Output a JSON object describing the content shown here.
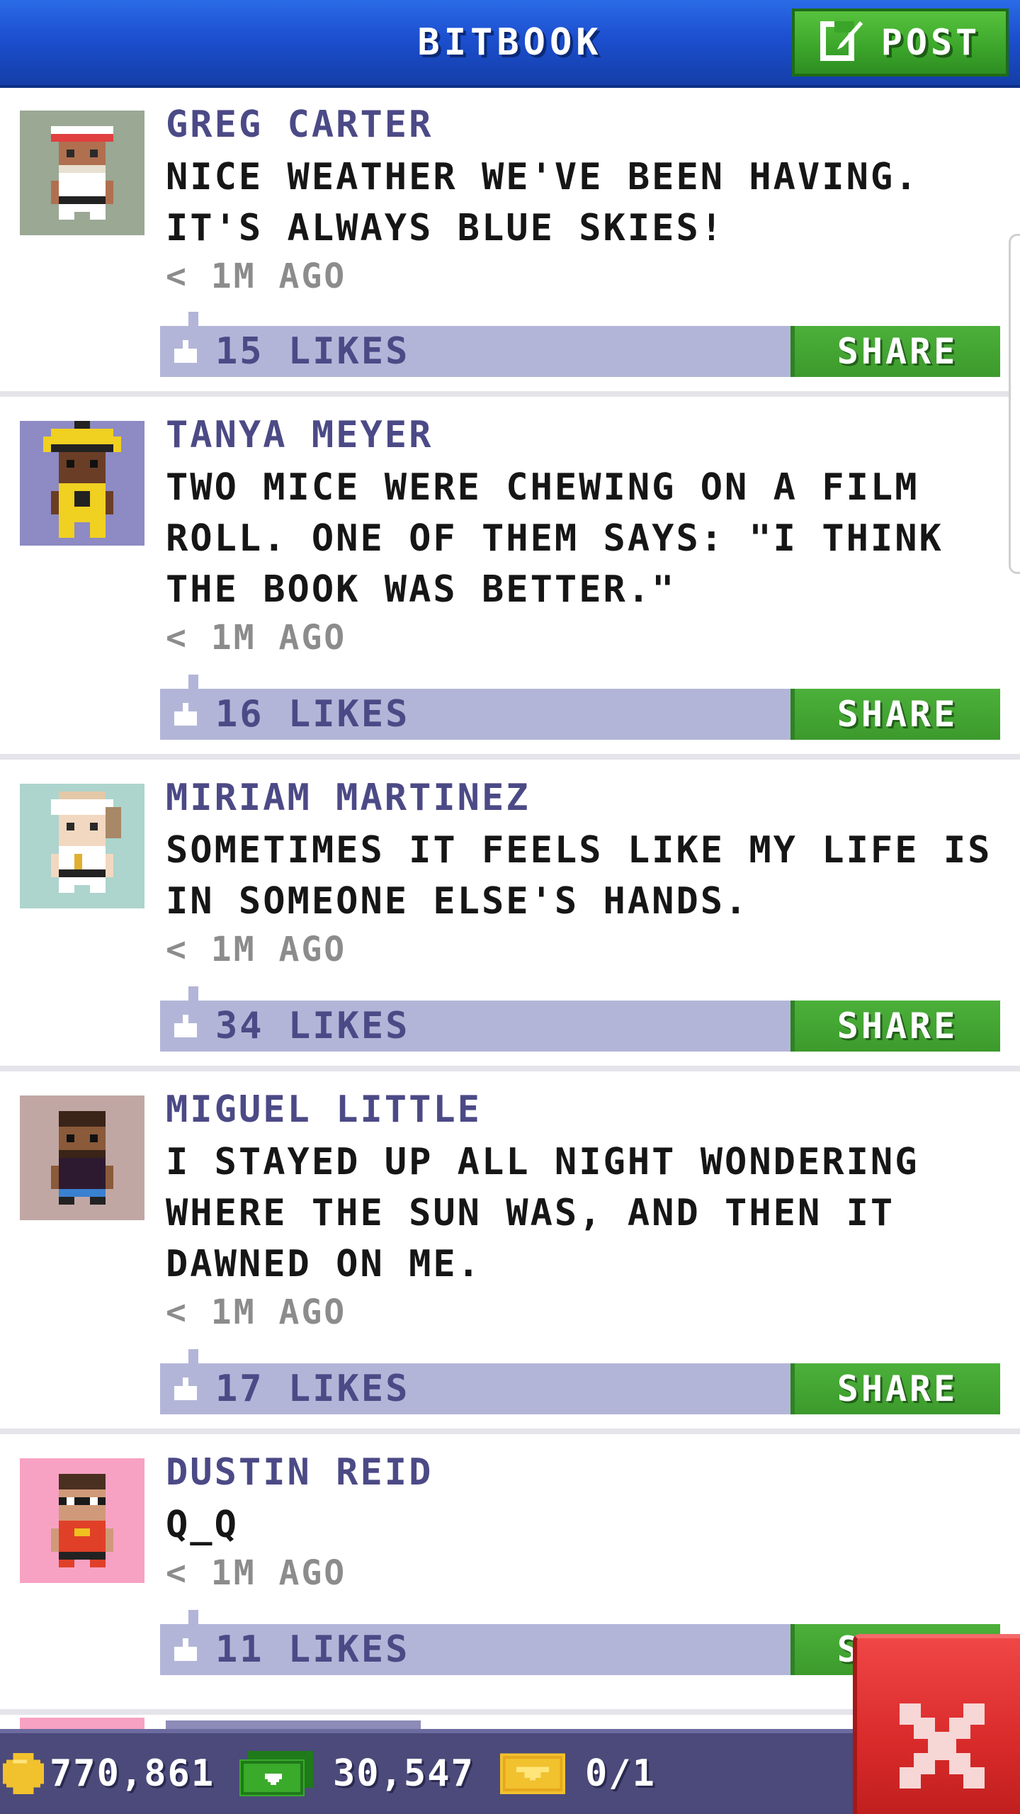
{
  "header": {
    "title": "BITBOOK",
    "post_label": "POST"
  },
  "feed": {
    "share_label": "SHARE",
    "posts": [
      {
        "author": "GREG CARTER",
        "message": "NICE WEATHER WE'VE BEEN HAVING. IT'S ALWAYS BLUE SKIES!",
        "time": "< 1M AGO",
        "likes": "15 LIKES",
        "avatar_bg": "#9aa894"
      },
      {
        "author": "TANYA MEYER",
        "message": "TWO MICE WERE CHEWING ON A FILM ROLL. ONE OF THEM SAYS: \"I THINK THE BOOK WAS BETTER.\"",
        "time": "< 1M AGO",
        "likes": "16 LIKES",
        "avatar_bg": "#8d8ac4"
      },
      {
        "author": "MIRIAM MARTINEZ",
        "message": "SOMETIMES IT FEELS LIKE MY LIFE IS IN SOMEONE ELSE'S HANDS.",
        "time": "< 1M AGO",
        "likes": "34 LIKES",
        "avatar_bg": "#add4cd"
      },
      {
        "author": "MIGUEL LITTLE",
        "message": "I STAYED UP ALL NIGHT WONDERING WHERE THE SUN WAS, AND THEN IT DAWNED ON ME.",
        "time": "< 1M AGO",
        "likes": "17 LIKES",
        "avatar_bg": "#c1a7a3"
      },
      {
        "author": "DUSTIN REID",
        "message": "Q_Q",
        "time": "< 1M AGO",
        "likes": "11 LIKES",
        "avatar_bg": "#f7a2c3"
      }
    ]
  },
  "status": {
    "coins": "770,861",
    "bux": "30,547",
    "vip": "0/1"
  },
  "colors": {
    "header_blue": "#1c4fcf",
    "post_green": "#3ba52a",
    "like_bar": "#b3b5d8",
    "author_purple": "#4c4a86",
    "status_bar": "#4b4a7a",
    "close_red": "#d92a2a"
  },
  "icons": {
    "post": "compose-icon",
    "like": "thumbs-up-icon",
    "coin": "coin-icon",
    "bux": "bux-icon",
    "vip": "ticket-icon",
    "close": "close-icon"
  }
}
